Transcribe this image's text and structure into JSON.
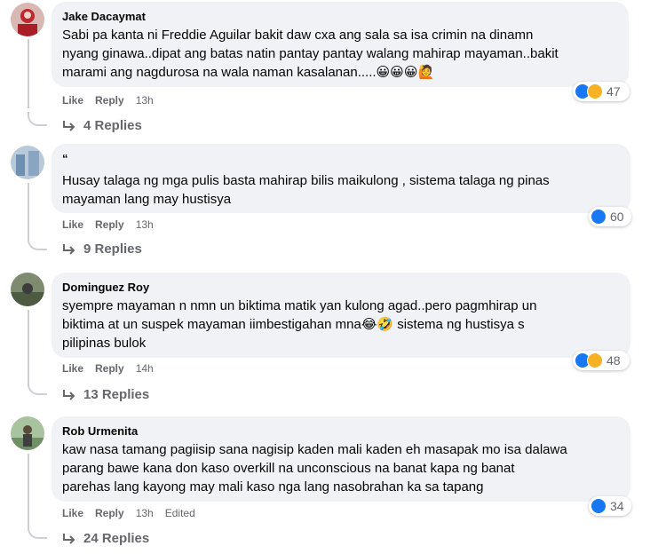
{
  "comments": [
    {
      "author": "Jake Dacaymat",
      "text": "Sabi pa kanta ni Freddie Aguilar bakit daw cxa ang sala sa isa crimin na dinamn\nnyang ginawa..dipat ang batas natin pantay pantay walang mahirap mayaman..bakit\nmarami ang nagdurosa na wala naman kasalanan.....😀😀😀🙋",
      "like_label": "Like",
      "reply_label": "Reply",
      "time": "13h",
      "reaction_count": "47",
      "replies_label": "4 Replies"
    },
    {
      "author": "“",
      "text": "Husay talaga ng mga pulis basta mahirap bilis maikulong , sistema talaga ng pinas\nmayaman lang may hustisya",
      "like_label": "Like",
      "reply_label": "Reply",
      "time": "13h",
      "reaction_count": "60",
      "replies_label": "9 Replies"
    },
    {
      "author": "Dominguez Roy",
      "text": "syempre mayaman n nmn un biktima matik yan kulong agad..pero pagmhirap un\nbiktima at un suspek mayaman iimbestigahan mna😂🤣 sistema ng hustisya s\npilipinas bulok",
      "like_label": "Like",
      "reply_label": "Reply",
      "time": "14h",
      "reaction_count": "48",
      "replies_label": "13 Replies"
    },
    {
      "author": "Rob Urmenita",
      "text": "kaw nasa tamang pagiisip sana nagisip kaden mali kaden eh masapak mo isa dalawa\nparang bawe kana don kaso overkill na unconscious na banat kapa ng banat\nparehas lang kayong may mali kaso nga lang nasobrahan ka sa tapang",
      "like_label": "Like",
      "reply_label": "Reply",
      "time": "13h",
      "edited": "Edited",
      "reaction_count": "34",
      "replies_label": "24 Replies"
    }
  ],
  "colors": {
    "bubble": "#f0f2f5",
    "meta": "#65676b",
    "like_blue": "#1877f2",
    "haha_yellow": "#f7b125"
  },
  "icons": [
    "like-icon",
    "haha-icon",
    "reply-arrow-icon",
    "avatar"
  ]
}
